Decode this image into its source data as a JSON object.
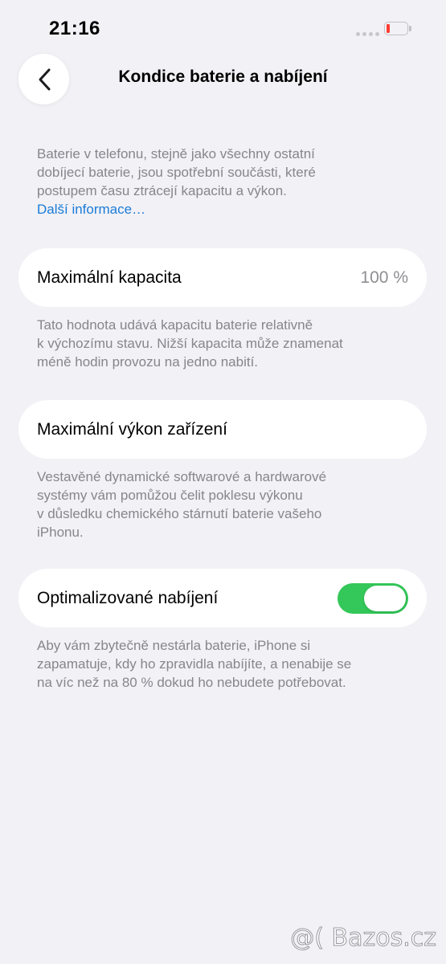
{
  "status_bar": {
    "time": "21:16",
    "battery_color": "#ff3b30"
  },
  "nav": {
    "back_icon": "chevron-left-icon",
    "title": "Kondice baterie a nabíjení"
  },
  "intro": {
    "lines": [
      "Baterie v telefonu, stejně jako všechny ostatní",
      "dobíjecí baterie, jsou spotřební součásti, které",
      "postupem času ztrácejí kapacitu a výkon."
    ],
    "link": "Další informace…"
  },
  "max_capacity": {
    "label": "Maximální kapacita",
    "value": "100 %",
    "footnote_lines": [
      "Tato hodnota udává kapacitu baterie relativně",
      "k výchozímu stavu. Nižší kapacita může znamenat",
      "méně hodin provozu na jedno nabití."
    ]
  },
  "peak_performance": {
    "label": "Maximální výkon zařízení",
    "footnote_lines": [
      "Vestavěné dynamické softwarové a hardwarové",
      "systémy vám pomůžou čelit poklesu výkonu",
      "v důsledku chemického stárnutí baterie vašeho",
      "iPhonu."
    ]
  },
  "optimized_charging": {
    "label": "Optimalizované nabíjení",
    "enabled": true,
    "toggle_color": "#34c759",
    "footnote_lines": [
      "Aby vám zbytečně nestárla baterie, iPhone si",
      "zapamatuje, kdy ho zpravidla nabíjíte, a nenabije se",
      "na víc než na 80 % dokud ho nebudete potřebovat."
    ]
  },
  "watermark": {
    "text": "@( Bazos.cz"
  }
}
